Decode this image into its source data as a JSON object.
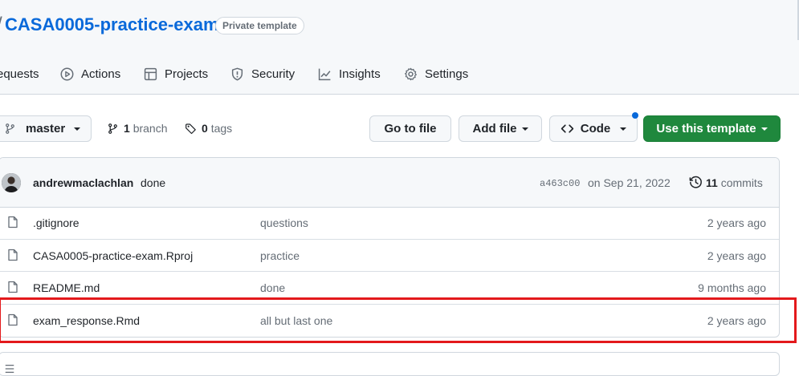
{
  "repo": {
    "name": "CASA0005-practice-exam",
    "visibility": "Private template"
  },
  "nav": {
    "items": [
      {
        "label": "equests",
        "icon": "pull-request-icon"
      },
      {
        "label": "Actions",
        "icon": "play-icon"
      },
      {
        "label": "Projects",
        "icon": "table-icon"
      },
      {
        "label": "Security",
        "icon": "shield-icon"
      },
      {
        "label": "Insights",
        "icon": "graph-icon"
      },
      {
        "label": "Settings",
        "icon": "gear-icon"
      }
    ]
  },
  "toolbar": {
    "branch": "master",
    "branch_count": "1",
    "branch_label": "branch",
    "tag_count": "0",
    "tag_label": "tags",
    "goto_file": "Go to file",
    "add_file": "Add file",
    "code": "Code",
    "use_template": "Use this template"
  },
  "latest_commit": {
    "author": "andrewmaclachlan",
    "message": "done",
    "sha": "a463c00",
    "date": "on Sep 21, 2022",
    "commit_count": "11",
    "commit_label": "commits"
  },
  "files": [
    {
      "name": ".gitignore",
      "message": "questions",
      "age": "2 years ago"
    },
    {
      "name": "CASA0005-practice-exam.Rproj",
      "message": "practice",
      "age": "2 years ago"
    },
    {
      "name": "README.md",
      "message": "done",
      "age": "9 months ago"
    },
    {
      "name": "exam_response.Rmd",
      "message": "all but last one",
      "age": "2 years ago"
    }
  ],
  "colors": {
    "accent": "#0969da",
    "primary_button": "#1f883d",
    "highlight": "#e3191c"
  }
}
